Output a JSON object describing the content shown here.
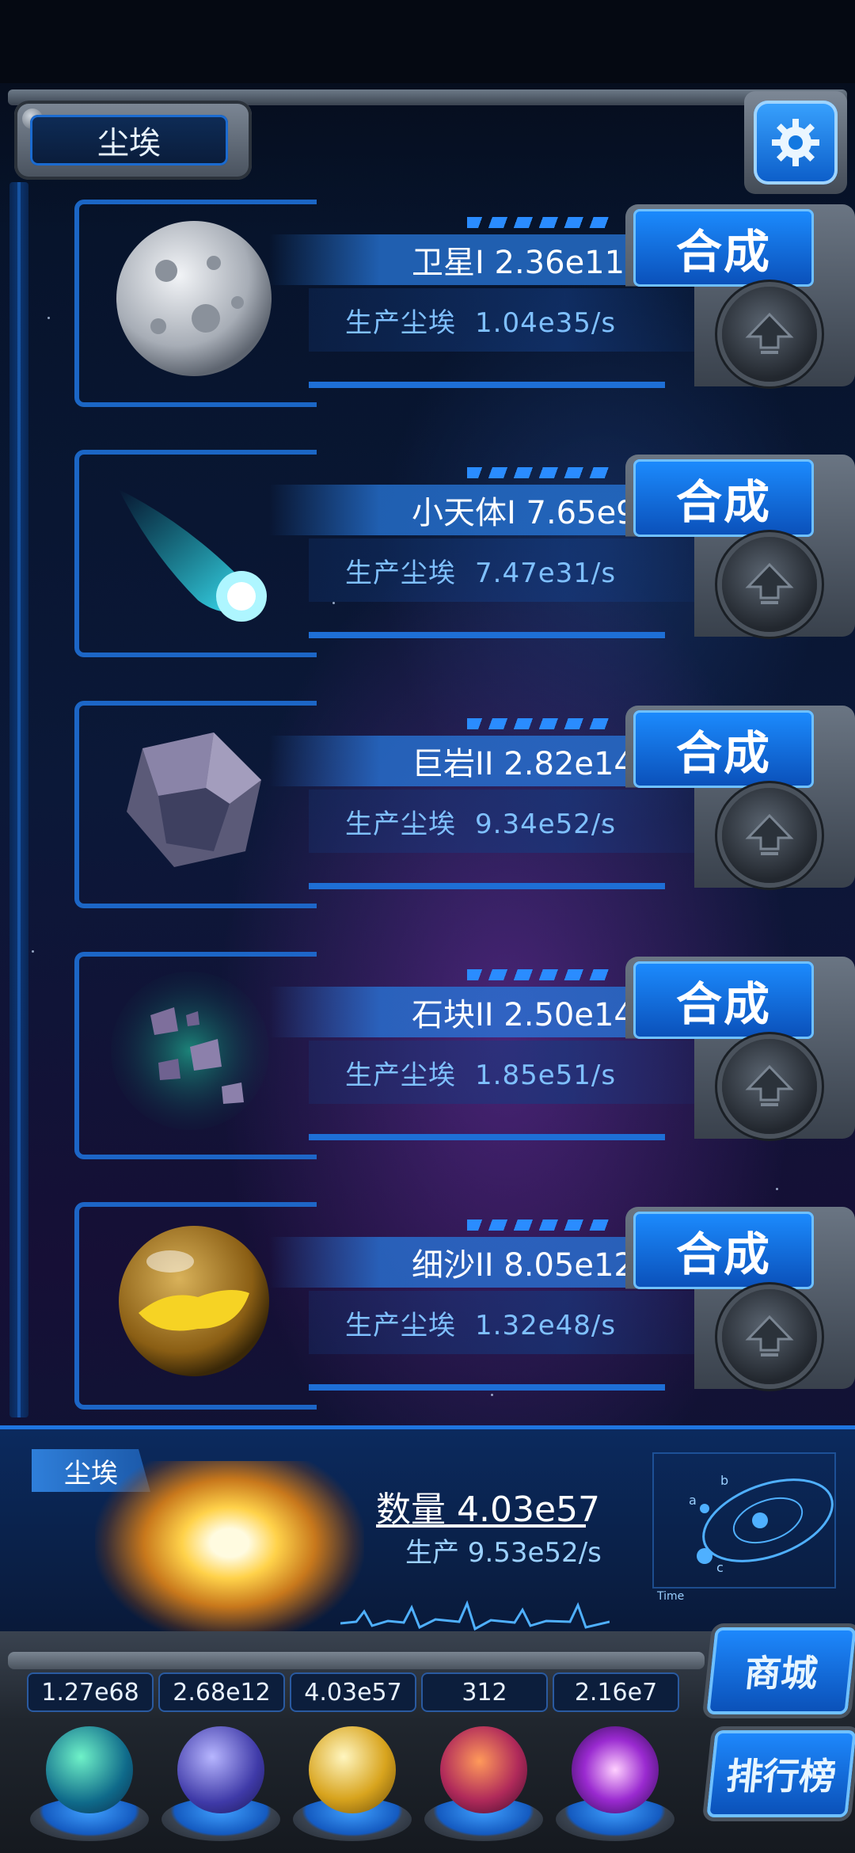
{
  "header": {
    "title": "尘埃"
  },
  "cards": [
    {
      "name": "卫星I 2.36e11",
      "prod_label": "生产尘埃",
      "prod_value": "1.04e35/s",
      "combine_label": "合成"
    },
    {
      "name": "小天体I 7.65e9",
      "prod_label": "生产尘埃",
      "prod_value": "7.47e31/s",
      "combine_label": "合成"
    },
    {
      "name": "巨岩II 2.82e14",
      "prod_label": "生产尘埃",
      "prod_value": "9.34e52/s",
      "combine_label": "合成"
    },
    {
      "name": "石块II 2.50e14",
      "prod_label": "生产尘埃",
      "prod_value": "1.85e51/s",
      "combine_label": "合成"
    },
    {
      "name": "细沙II 8.05e12",
      "prod_label": "生产尘埃",
      "prod_value": "1.32e48/s",
      "combine_label": "合成"
    }
  ],
  "dust_panel": {
    "tag": "尘埃",
    "quantity": "数量 4.03e57",
    "rate": "生产 9.53e52/s",
    "orbit_labels": [
      "a",
      "b",
      "c",
      "Time"
    ]
  },
  "dock": {
    "resources": [
      "1.27e68",
      "2.68e12",
      "4.03e57",
      "312",
      "2.16e7"
    ],
    "slots": [
      "atom-orb",
      "lightning-orb",
      "dust-orb",
      "brain-orb",
      "vortex-orb"
    ]
  },
  "buttons": {
    "shop": "商城",
    "rank": "排行榜"
  },
  "colors": {
    "accent": "#1e8aff",
    "panel": "#0b2a5e",
    "text": "#ffffff",
    "subtext": "#7fc0ff"
  }
}
